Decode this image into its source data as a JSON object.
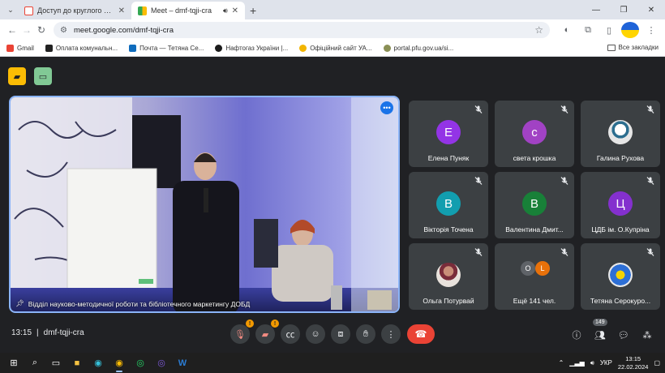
{
  "browser": {
    "tabs": [
      {
        "title": "Доступ до круглого столу «Н",
        "favicon": "gmail-icon",
        "active": false
      },
      {
        "title": "Meet – dmf-tqji-cra",
        "favicon": "meet-icon",
        "active": true
      }
    ],
    "url": "meet.google.com/dmf-tqji-cra",
    "bookmarks": [
      {
        "label": "Gmail",
        "color": "#ea4335"
      },
      {
        "label": "Оплата комунальн...",
        "color": "#222222"
      },
      {
        "label": "Почта — Тетяна Се...",
        "color": "#0f6cbd"
      },
      {
        "label": "Нафтогаз України |...",
        "color": "#1c1c1c"
      },
      {
        "label": "Офіційний сайт УА...",
        "color": "#f2b500"
      },
      {
        "label": "portal.pfu.gov.ua/si...",
        "color": "#8a8f55"
      }
    ],
    "all_bookmarks": "Все закладки"
  },
  "meet": {
    "main_video": {
      "label": "Відділ науково-методичної роботи та бібліотечного маркетингу ДОБД"
    },
    "participants": [
      {
        "name": "Елена Пуняк",
        "initial": "Е",
        "color": "#9334e6",
        "type": "initial"
      },
      {
        "name": "света крошка",
        "initial": "с",
        "color": "#a142c4",
        "type": "initial"
      },
      {
        "name": "Галина Рухова",
        "initial": "",
        "color": "#3c4043",
        "type": "photo"
      },
      {
        "name": "Вікторія Точена",
        "initial": "В",
        "color": "#129eaf",
        "type": "initial"
      },
      {
        "name": "Валентина Дмит...",
        "initial": "В",
        "color": "#188038",
        "type": "initial"
      },
      {
        "name": "ЦДБ ім. О.Купріна",
        "initial": "Ц",
        "color": "#8430ce",
        "type": "initial"
      },
      {
        "name": "Ольга Потурвай",
        "initial": "",
        "color": "#3c4043",
        "type": "photo"
      },
      {
        "name": "Ещё 141 чел.",
        "initial": "",
        "color": "#3c4043",
        "type": "more"
      },
      {
        "name": "Тетяна Серокуро...",
        "initial": "",
        "color": "#3c4043",
        "type": "photo"
      }
    ],
    "more_avatars": [
      "О",
      "L"
    ],
    "time": "13:15",
    "code": "dmf-tqji-cra",
    "people_count": "149"
  },
  "taskbar": {
    "lang": "УКР",
    "time": "13:15",
    "date": "22.02.2024"
  }
}
